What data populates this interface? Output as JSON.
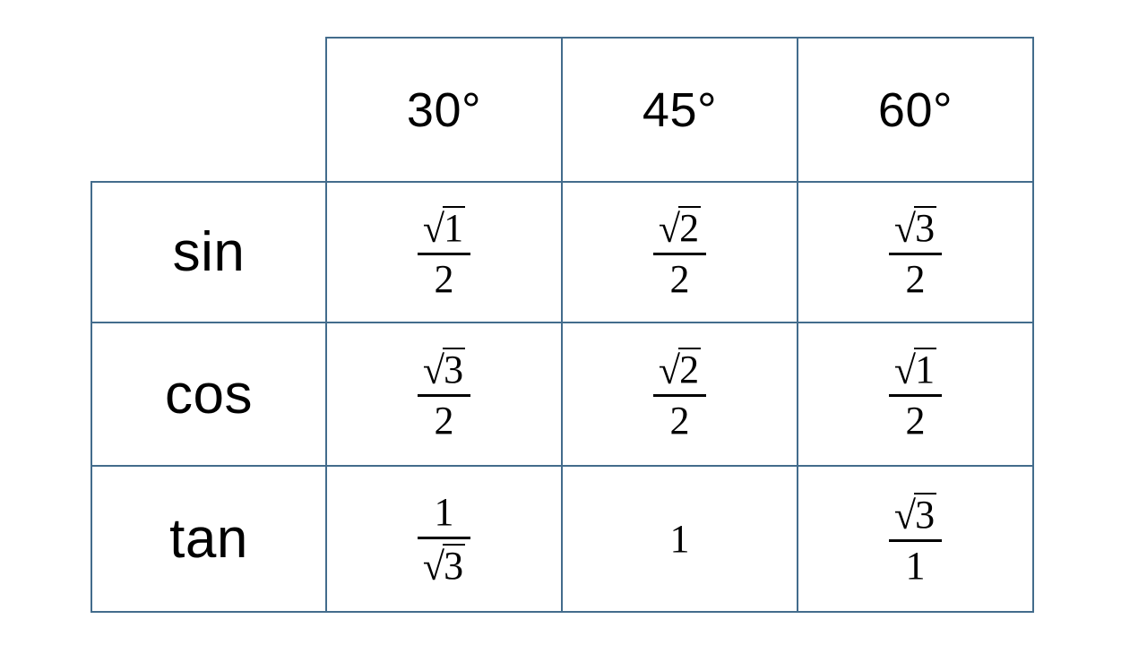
{
  "table": {
    "corner_label": "",
    "column_headers": [
      "30°",
      "45°",
      "60°"
    ],
    "row_labels": [
      "sin",
      "cos",
      "tan"
    ],
    "border_color": "#436c8c",
    "text_color": "#000000",
    "background_color": "#ffffff",
    "rows": [
      {
        "label": "sin",
        "cells": [
          {
            "display": "√1/2",
            "type": "fraction",
            "numerator": "√1",
            "numerator_radical": "1",
            "denominator": "2",
            "denominator_radical": null
          },
          {
            "display": "√2/2",
            "type": "fraction",
            "numerator": "√2",
            "numerator_radical": "2",
            "denominator": "2",
            "denominator_radical": null
          },
          {
            "display": "√3/2",
            "type": "fraction",
            "numerator": "√3",
            "numerator_radical": "3",
            "denominator": "2",
            "denominator_radical": null
          }
        ]
      },
      {
        "label": "cos",
        "cells": [
          {
            "display": "√3/2",
            "type": "fraction",
            "numerator": "√3",
            "numerator_radical": "3",
            "denominator": "2",
            "denominator_radical": null
          },
          {
            "display": "√2/2",
            "type": "fraction",
            "numerator": "√2",
            "numerator_radical": "2",
            "denominator": "2",
            "denominator_radical": null
          },
          {
            "display": "√1/2",
            "type": "fraction",
            "numerator": "√1",
            "numerator_radical": "1",
            "denominator": "2",
            "denominator_radical": null
          }
        ]
      },
      {
        "label": "tan",
        "cells": [
          {
            "display": "1/√3",
            "type": "fraction",
            "numerator": "1",
            "numerator_radical": null,
            "denominator": "√3",
            "denominator_radical": "3"
          },
          {
            "display": "1",
            "type": "plain",
            "value": "1"
          },
          {
            "display": "√3/1",
            "type": "fraction",
            "numerator": "√3",
            "numerator_radical": "3",
            "denominator": "1",
            "denominator_radical": null
          }
        ]
      }
    ]
  },
  "glyphs": {
    "radical_sign": "√"
  }
}
